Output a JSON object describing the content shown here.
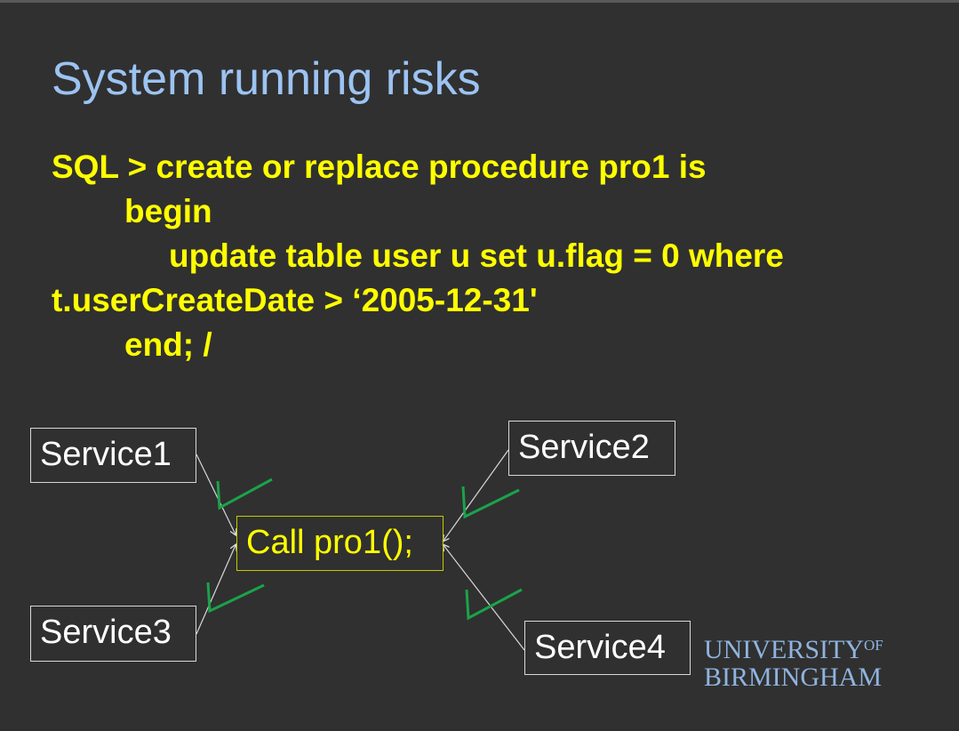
{
  "slide": {
    "title": "System running risks",
    "code_lines": [
      "SQL > create or replace procedure pro1 is",
      "begin",
      "update table user u set u.flag = 0  where",
      "t.userCreateDate > ‘2005-12-31'",
      "end; /"
    ]
  },
  "diagram": {
    "center": "Call pro1();",
    "services": [
      "Service1",
      "Service2",
      "Service3",
      "Service4"
    ]
  },
  "logo": {
    "line1": "UNIVERSITY",
    "of": "OF",
    "line2": "BIRMINGHAM"
  },
  "colors": {
    "background": "#303030",
    "title": "#9cc3f2",
    "code": "#ffff00",
    "check": "#1aa34a",
    "logo": "#8fb4e0"
  }
}
